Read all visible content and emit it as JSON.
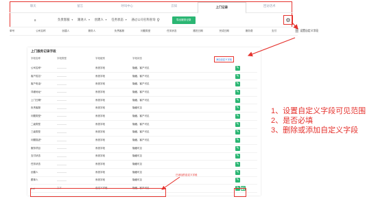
{
  "tabs": [
    "聊天",
    "留言",
    "呼叫中心",
    "云知",
    "上门记录",
    "回访话术"
  ],
  "filter": {
    "date_value": "8",
    "owner": "负责客服",
    "creator_sel": "跟进人",
    "creator2": "创建人",
    "status": "任务状态",
    "search_placeholder": "通过公司名称查询",
    "export_button": "导出服务记录"
  },
  "settings_popup_label": "设置自定义字段",
  "columns": [
    "单号",
    "公司名称",
    "创建人",
    "服务人",
    "负责客服",
    "问题类型",
    "任务状态",
    "跟进日期",
    "完成日期",
    "服务费",
    "支付"
  ],
  "panel": {
    "title": "上门服务记录字段",
    "headers": [
      "字段名称",
      "字段类型",
      "字段组别",
      "字段状态"
    ],
    "add_button": "添加自定义字段",
    "rows": [
      {
        "name": "公司名称*",
        "type": "————",
        "group": "系统字段",
        "status": "隐藏、客户可见"
      },
      {
        "name": "客户姓名*",
        "type": "————",
        "group": "系统字段",
        "status": "隐藏、客户可见"
      },
      {
        "name": "客户电话*",
        "type": "————",
        "group": "系统字段",
        "status": "隐藏、客户可见"
      },
      {
        "name": "详细地址*",
        "type": "————",
        "group": "系统字段",
        "status": "隐藏、客户可见"
      },
      {
        "name": "上门日期*",
        "type": "————",
        "group": "系统字段",
        "status": "隐藏、客户可见"
      },
      {
        "name": "负责客服",
        "type": "————",
        "group": "系统字段",
        "status": "隐藏可见"
      },
      {
        "name": "问题类型*",
        "type": "————",
        "group": "系统字段",
        "status": "隐藏、客户可见"
      },
      {
        "name": "二级类型",
        "type": "————",
        "group": "系统字段",
        "status": "隐藏、客户可见"
      },
      {
        "name": "三级类型",
        "type": "————",
        "group": "系统字段",
        "status": "隐藏、客户可见"
      },
      {
        "name": "问题描述*",
        "type": "————",
        "group": "系统字段",
        "status": "隐藏、客户可见"
      },
      {
        "name": "服务项目",
        "type": "————",
        "group": "系统字段",
        "status": "隐藏可见"
      },
      {
        "name": "支付状态",
        "type": "————",
        "group": "系统字段",
        "status": "隐藏可见"
      },
      {
        "name": "任务状态",
        "type": "————",
        "group": "系统字段",
        "status": "隐藏可见"
      },
      {
        "name": "创建人",
        "type": "————",
        "group": "系统字段",
        "status": "隐藏可见"
      },
      {
        "name": "跟单人",
        "type": "————",
        "group": "系统字段",
        "status": "隐藏可见"
      },
      {
        "name": "test",
        "type": "文本",
        "group": "自定义字段",
        "status": "隐藏、客户可见"
      }
    ]
  },
  "callout": "已添加的自定义字段",
  "notes": [
    "1、设置自定义字段可见范围",
    "2、是否必填",
    "3、删除或添加自定义字段"
  ],
  "colors": {
    "accent_red": "#e5322d",
    "green": "#2bb673",
    "link_blue": "#2b7be4"
  }
}
